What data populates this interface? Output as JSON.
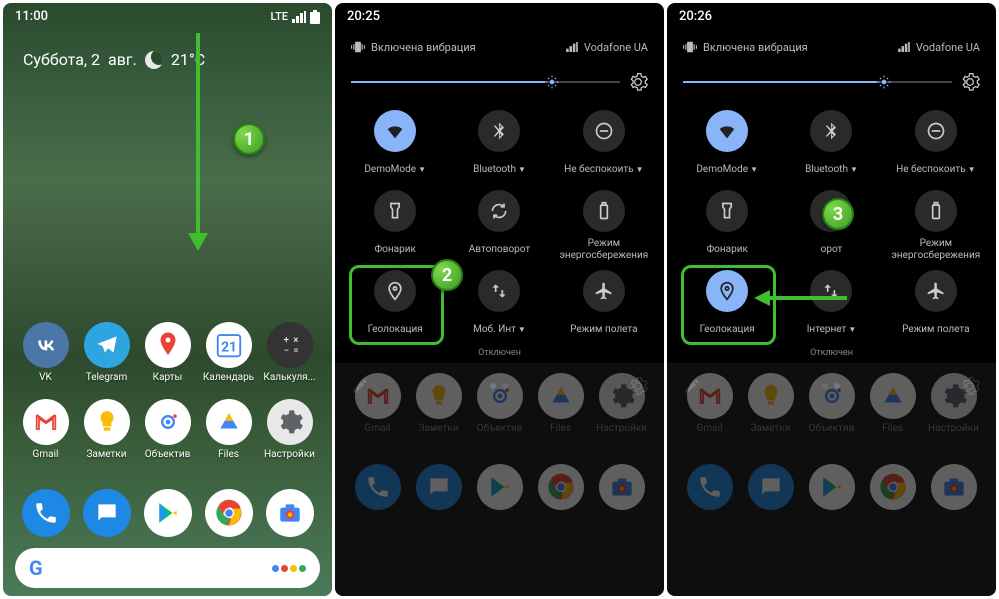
{
  "panel1": {
    "time": "11:00",
    "signal": "LTE",
    "weather": {
      "day": "Суббота, 2",
      "month": "авг.",
      "temp": "21°C"
    },
    "apps_row1": [
      {
        "name": "vk",
        "label": "VK",
        "bg": "#4a76a8"
      },
      {
        "name": "telegram",
        "label": "Telegram",
        "bg": "#2ca5e0"
      },
      {
        "name": "maps",
        "label": "Карты",
        "bg": "#fff"
      },
      {
        "name": "calendar",
        "label": "Календарь",
        "bg": "#fff"
      },
      {
        "name": "calculator",
        "label": "Калькуля...",
        "bg": "#333"
      }
    ],
    "apps_row2": [
      {
        "name": "gmail",
        "label": "Gmail",
        "bg": "#fff"
      },
      {
        "name": "keep",
        "label": "Заметки",
        "bg": "#fff"
      },
      {
        "name": "lens",
        "label": "Объектив",
        "bg": "#fff"
      },
      {
        "name": "files",
        "label": "Files",
        "bg": "#fff"
      },
      {
        "name": "settings",
        "label": "Настройки",
        "bg": "#e8e8e8"
      }
    ],
    "dock": [
      {
        "name": "phone",
        "bg": "#1e88e5"
      },
      {
        "name": "messages",
        "bg": "#1e88e5"
      },
      {
        "name": "playstore",
        "bg": "#fff"
      },
      {
        "name": "chrome",
        "bg": "#fff"
      },
      {
        "name": "camera",
        "bg": "#fff"
      }
    ]
  },
  "panel2": {
    "time": "20:25",
    "vibration": "Включена вибрация",
    "carrier": "Vodafone UA",
    "tiles": [
      {
        "name": "wifi",
        "label": "DemoMode",
        "active": true,
        "dropdown": true
      },
      {
        "name": "bluetooth",
        "label": "Bluetooth",
        "dropdown": true
      },
      {
        "name": "dnd",
        "label": "Не беспокоить",
        "dropdown": true
      },
      {
        "name": "flashlight",
        "label": "Фонарик"
      },
      {
        "name": "rotate",
        "label": "Автоповорот"
      },
      {
        "name": "battery",
        "label": "Режим энергосбережения"
      },
      {
        "name": "location",
        "label": "Геолокация",
        "active": false
      },
      {
        "name": "data",
        "label": "Моб. Инт",
        "sub": "Отключен",
        "dropdown": true
      },
      {
        "name": "airplane",
        "label": "Режим полета"
      }
    ]
  },
  "panel3": {
    "time": "20:26",
    "vibration": "Включена вибрация",
    "carrier": "Vodafone UA",
    "tiles": [
      {
        "name": "wifi",
        "label": "DemoMode",
        "active": true,
        "dropdown": true
      },
      {
        "name": "bluetooth",
        "label": "Bluetooth",
        "dropdown": true
      },
      {
        "name": "dnd",
        "label": "Не беспокоить",
        "dropdown": true
      },
      {
        "name": "flashlight",
        "label": "Фонарик"
      },
      {
        "name": "rotate",
        "label": "орот"
      },
      {
        "name": "battery",
        "label": "Режим энергосбережения"
      },
      {
        "name": "location",
        "label": "Геолокация",
        "active": true
      },
      {
        "name": "data",
        "label": "Інтернет",
        "sub": "Отключен",
        "dropdown": true
      },
      {
        "name": "airplane",
        "label": "Режим полета"
      }
    ]
  },
  "markers": {
    "m1": "1",
    "m2": "2",
    "m3": "3"
  },
  "dimmed_apps": [
    "Gmail",
    "Заметки",
    "Объектив",
    "Files",
    "Настройки"
  ]
}
